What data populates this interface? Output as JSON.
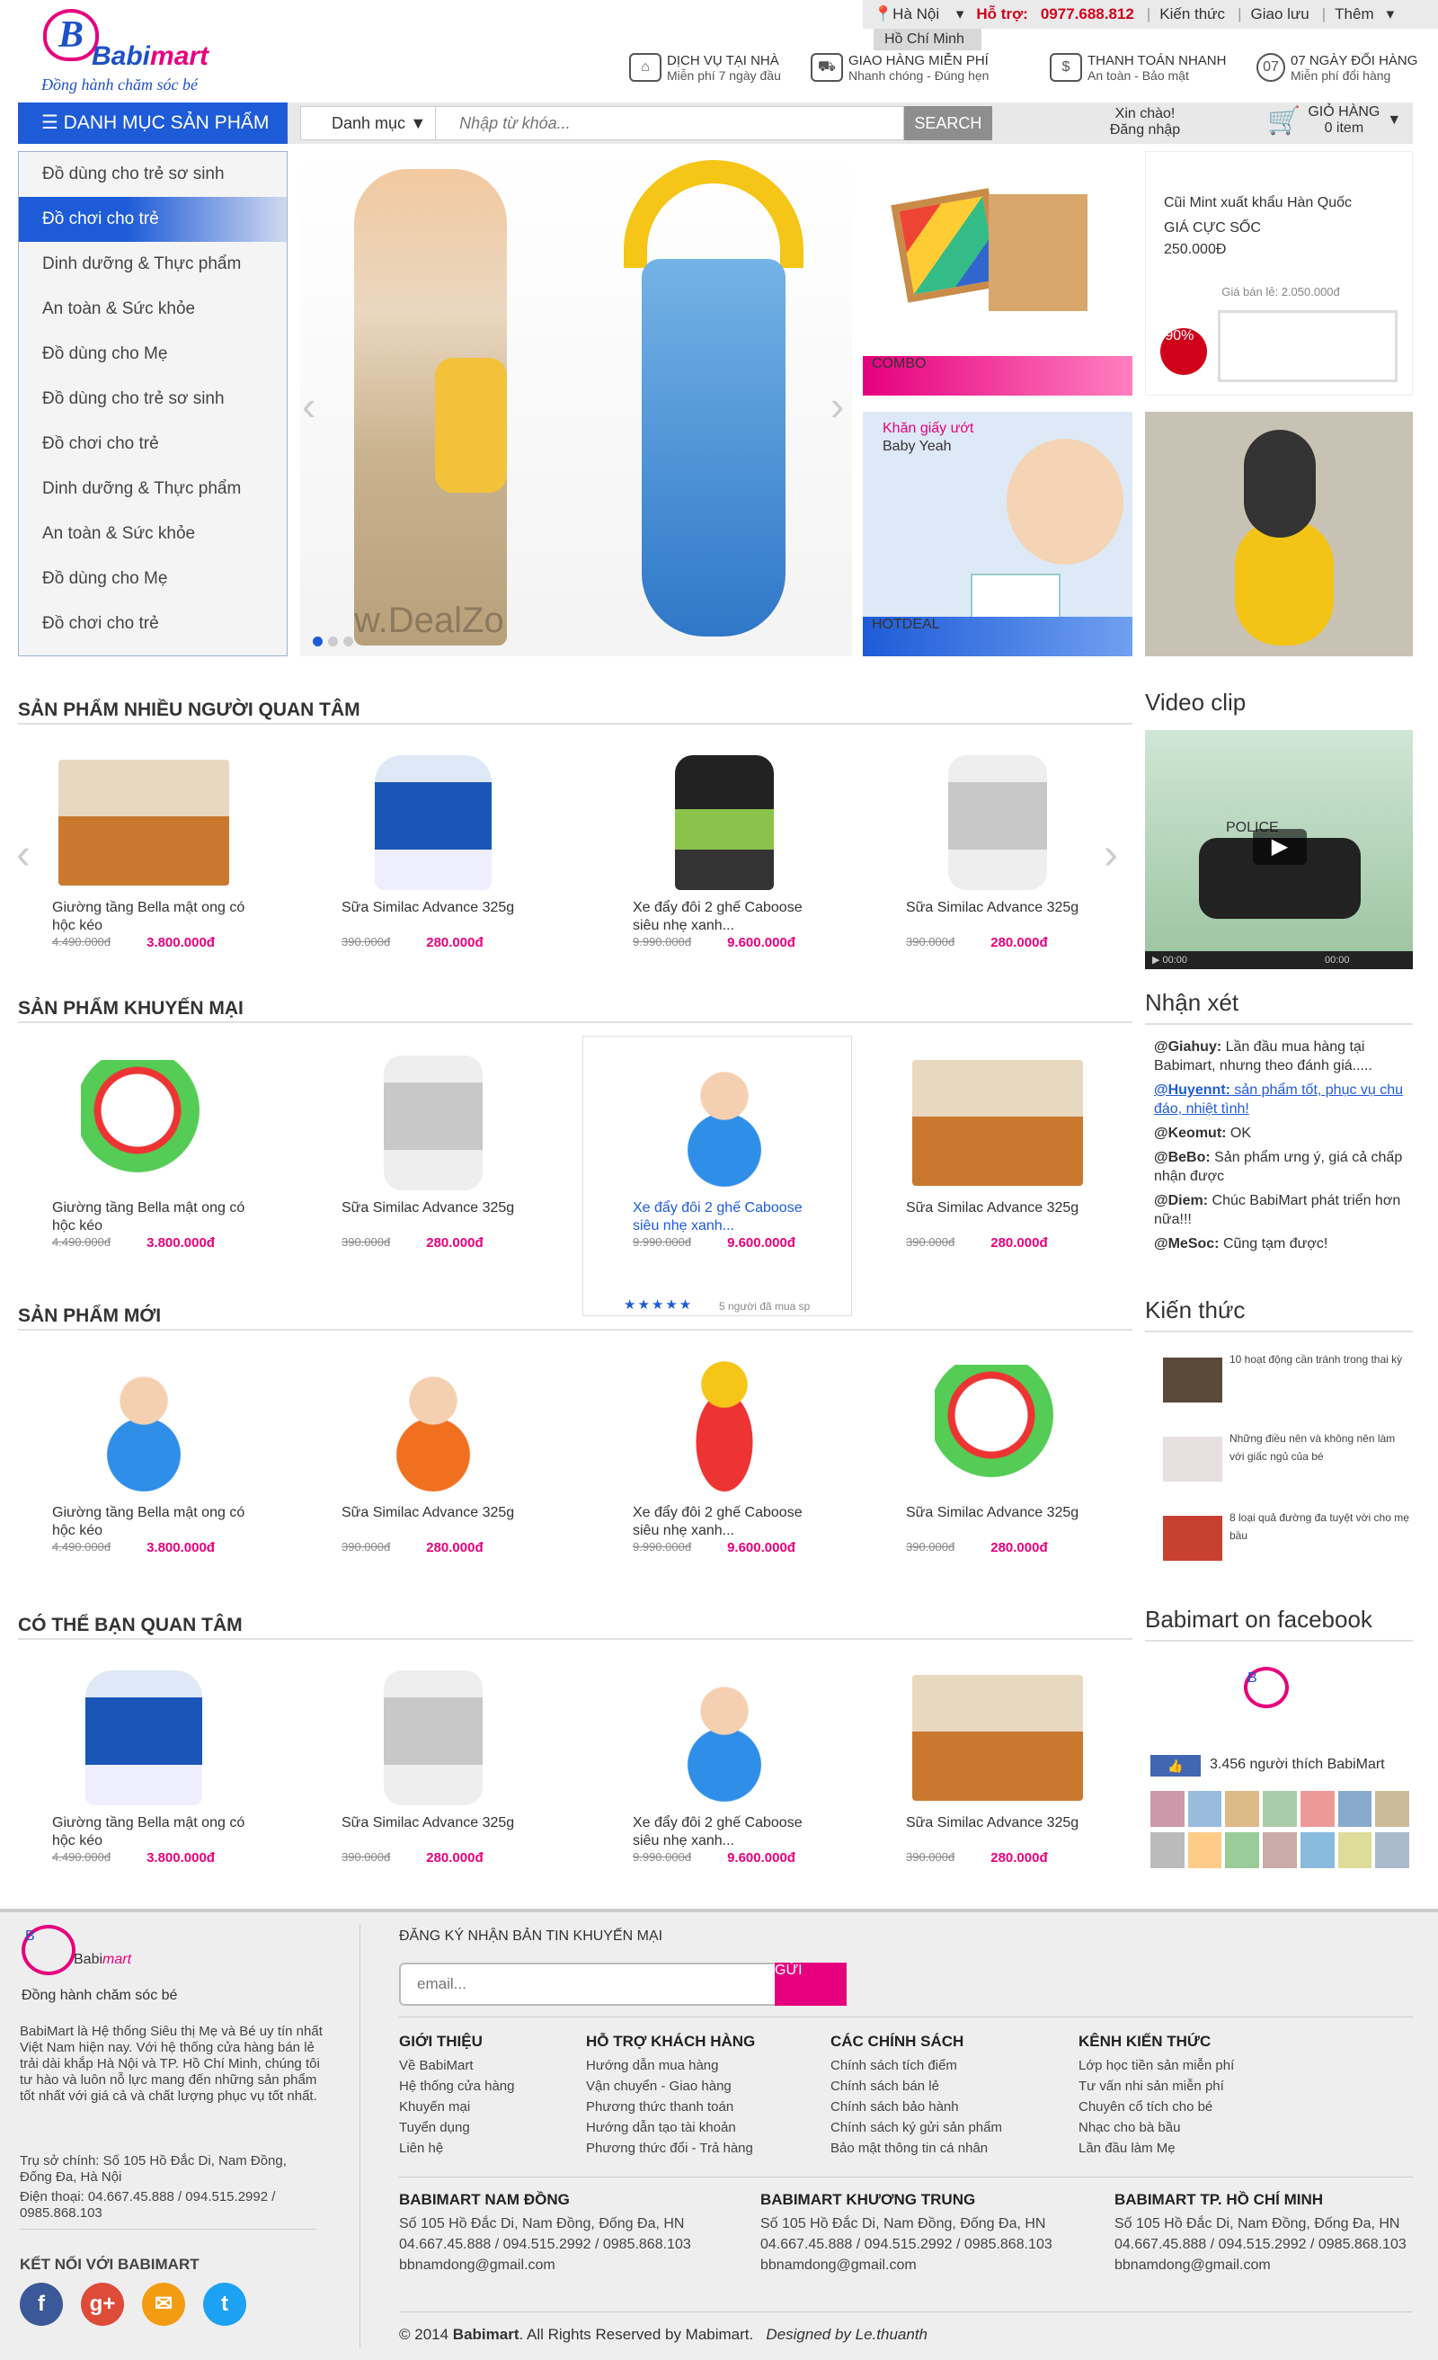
{
  "topbar": {
    "city_current": "Hà Nội",
    "city_option": "Hồ Chí Minh",
    "support_label": "Hỗ trợ:",
    "support_phone": "0977.688.812",
    "links": [
      "Kiến thức",
      "Giao lưu",
      "Thêm"
    ]
  },
  "logo": {
    "brand1": "Babi",
    "brand2": "mart",
    "slogan": "Đồng hành chăm sóc bé"
  },
  "services": [
    {
      "title": "DỊCH VỤ TẠI NHÀ",
      "sub": "Miễn phí 7 ngày đầu"
    },
    {
      "title": "GIAO HÀNG MIỄN PHÍ",
      "sub": "Nhanh chóng - Đúng hẹn"
    },
    {
      "title": "THANH TOÁN NHANH",
      "sub": "An toàn - Bảo mật"
    },
    {
      "title": "07 NGÀY ĐỔI HÀNG",
      "sub": "Miễn phí đổi hàng"
    }
  ],
  "nav": {
    "category_button": "DANH MỤC SẢN PHẨM",
    "search_category": "Danh mục",
    "search_placeholder": "Nhập từ khóa...",
    "search_button": "SEARCH",
    "greeting": "Xin chào!",
    "login": "Đăng nhập",
    "cart_label": "GIỎ HÀNG",
    "cart_count": "0 item"
  },
  "sidebar": [
    "Đồ dùng cho trẻ sơ sinh",
    "Đồ chơi cho trẻ",
    "Dinh dưỡng & Thực phẩm",
    "An toàn & Sức khỏe",
    "Đồ dùng cho Mẹ",
    "Đồ dùng cho trẻ sơ sinh",
    "Đồ chơi cho trẻ",
    "Dinh dưỡng & Thực phẩm",
    "An toàn & Sức khỏe",
    "Đồ dùng cho Mẹ",
    "Đồ chơi cho trẻ"
  ],
  "banners": {
    "combo": "COMBO",
    "hotdeal": "HOTDEAL",
    "promo_title": "Cũi Mint xuất khẩu Hàn Quốc",
    "promo_price_label": "GIÁ CỰC SỐC",
    "promo_price": "250.000Đ",
    "promo_old": "Giá bán lẻ: 2.050.000đ",
    "promo_off": "-90%",
    "wipe_title": "Khăn giấy ướt",
    "wipe_brand": "Baby Yeah",
    "watermark": "w.DealZo"
  },
  "sections": {
    "popular": "SẢN PHẨM NHIỀU NGƯỜI QUAN TÂM",
    "promo": "SẢN PHẨM KHUYẾN MẠI",
    "new": "SẢN PHẨM MỚI",
    "maybe": "CÓ THỂ BẠN QUAN TÂM",
    "video": "Video clip",
    "comments": "Nhận xét",
    "knowledge": "Kiến thức",
    "facebook": "Babimart on facebook"
  },
  "products_popular": [
    {
      "name": "Giường tầng Bella mật ong có hộc kéo",
      "old": "4.490.000đ",
      "price": "3.800.000đ"
    },
    {
      "name": "Sữa Similac Advance 325g",
      "old": "390.000đ",
      "price": "280.000đ"
    },
    {
      "name": "Xe đẩy đôi 2 ghế Caboose siêu nhẹ xanh...",
      "old": "9.990.000đ",
      "price": "9.600.000đ"
    },
    {
      "name": "Sữa Similac Advance 325g",
      "old": "390.000đ",
      "price": "280.000đ"
    }
  ],
  "products_promo": [
    {
      "name": "Giường tầng Bella mật ong có hộc kéo",
      "old": "4.490.000đ",
      "price": "3.800.000đ"
    },
    {
      "name": "Sữa Similac Advance 325g",
      "old": "390.000đ",
      "price": "280.000đ"
    },
    {
      "name": "Xe đẩy đôi 2 ghế Caboose siêu nhẹ xanh...",
      "old": "9.990.000đ",
      "price": "9.600.000đ",
      "bought": "5 người đã mua sp"
    },
    {
      "name": "Sữa Similac Advance 325g",
      "old": "390.000đ",
      "price": "280.000đ"
    }
  ],
  "products_new": [
    {
      "name": "Giường tầng Bella mật ong có hộc kéo",
      "old": "4.490.000đ",
      "price": "3.800.000đ"
    },
    {
      "name": "Sữa Similac Advance 325g",
      "old": "390.000đ",
      "price": "280.000đ"
    },
    {
      "name": "Xe đẩy đôi 2 ghế Caboose siêu nhẹ xanh...",
      "old": "9.990.000đ",
      "price": "9.600.000đ"
    },
    {
      "name": "Sữa Similac Advance 325g",
      "old": "390.000đ",
      "price": "280.000đ"
    }
  ],
  "products_maybe": [
    {
      "name": "Giường tầng Bella mật ong có hộc kéo",
      "old": "4.490.000đ",
      "price": "3.800.000đ"
    },
    {
      "name": "Sữa Similac Advance 325g",
      "old": "390.000đ",
      "price": "280.000đ"
    },
    {
      "name": "Xe đẩy đôi 2 ghế Caboose siêu nhẹ xanh...",
      "old": "9.990.000đ",
      "price": "9.600.000đ"
    },
    {
      "name": "Sữa Similac Advance 325g",
      "old": "390.000đ",
      "price": "280.000đ"
    }
  ],
  "video": {
    "time_start": "00:00",
    "time_end": "00:00",
    "police": "POLICE"
  },
  "comments": [
    {
      "user": "@Giahuy:",
      "text": " Lần đầu mua hàng tại Babimart, nhưng theo đánh giá....."
    },
    {
      "user": "@Huyennt:",
      "text": " sản phẩm tốt, phục vụ chu đáo, nhiệt tình!"
    },
    {
      "user": "@Keomut:",
      "text": " OK"
    },
    {
      "user": "@BeBo:",
      "text": " Sản phẩm ưng ý, giá cả chấp nhận được"
    },
    {
      "user": "@Diem:",
      "text": " Chúc BabiMart phát triển hơn nữa!!!"
    },
    {
      "user": "@MeSoc:",
      "text": " Cũng tạm được!"
    }
  ],
  "knowledge": [
    "10 hoạt động cần tránh trong thai kỳ",
    "Những điều nên và không nên làm với giấc ngủ của bé",
    "8 loại quả đường đa tuyệt vời cho mẹ bầu"
  ],
  "facebook": {
    "like": "Thích",
    "count": "3.456 người thích BabiMart"
  },
  "footer": {
    "about": "BabiMart là Hệ thống Siêu thị Mẹ và Bé uy tín nhất Việt Nam hiện nay. Với hệ thống cửa hàng bán lẻ trải dài khắp Hà Nội và TP. Hồ Chí Minh, chúng tôi tư hào và luôn nỗ lực mang đến những sản phẩm tốt nhất với giá cả và chất lượng phục vụ tốt nhất.",
    "hq": "Trụ sở chính: Số 105 Hồ Đắc Di, Nam Đồng, Đống Đa, Hà Nội",
    "phone": "Điện thoại: 04.667.45.888 / 094.515.2992 / 0985.868.103",
    "connect": "KẾT NỐI VỚI BABIMART",
    "newsletter": "ĐĂNG KÝ NHẬN BẢN TIN KHUYẾN MẠI",
    "email_placeholder": "email...",
    "send": "GỬI",
    "cols": [
      {
        "title": "GIỚI THIỆU",
        "items": [
          "Về BabiMart",
          "Hệ thống cửa hàng",
          "Khuyến mại",
          "Tuyển dụng",
          "Liên hệ"
        ]
      },
      {
        "title": "HỖ TRỢ KHÁCH HÀNG",
        "items": [
          "Hướng dẫn mua hàng",
          "Vận chuyển - Giao hàng",
          "Phương thức thanh toán",
          "Hướng dẫn tạo tài khoản",
          "Phương thức đổi - Trả hàng"
        ]
      },
      {
        "title": "CÁC CHÍNH SÁCH",
        "items": [
          "Chính sách tích điểm",
          "Chính sách bán lẻ",
          "Chính sách bảo hành",
          "Chính sách ký gửi sản phẩm",
          "Bảo mật thông tin cá nhân"
        ]
      },
      {
        "title": "KÊNH KIẾN THỨC",
        "items": [
          "Lớp học tiền sản miễn phí",
          "Tư vấn nhi sản miễn phí",
          "Chuyên cổ tích cho bé",
          "Nhạc cho bà bầu",
          "Lần đầu làm Mẹ"
        ]
      }
    ],
    "stores": [
      {
        "title": "BABIMART NAM ĐỒNG",
        "addr": "Số 105 Hồ Đắc Di, Nam Đồng, Đống Đa, HN",
        "phone": "04.667.45.888 / 094.515.2992 / 0985.868.103",
        "email": "bbnamdong@gmail.com"
      },
      {
        "title": "BABIMART KHƯƠNG TRUNG",
        "addr": "Số 105 Hồ Đắc Di, Nam Đồng, Đống Đa, HN",
        "phone": "04.667.45.888 / 094.515.2992 / 0985.868.103",
        "email": "bbnamdong@gmail.com"
      },
      {
        "title": "BABIMART TP. HỒ CHÍ MINH",
        "addr": "Số 105 Hồ Đắc Di, Nam Đồng, Đống Đa, HN",
        "phone": "04.667.45.888 / 094.515.2992 / 0985.868.103",
        "email": "bbnamdong@gmail.com"
      }
    ],
    "copyright_pre": "© 2014 ",
    "copyright_brand": "Babimart",
    "copyright_post": ". All Rights Reserved by Mabimart.",
    "designed": "Designed by Le.thuanth"
  },
  "colors": {
    "primary": "#1e5bd8",
    "accent": "#e6007e",
    "support": "#d0021b"
  }
}
